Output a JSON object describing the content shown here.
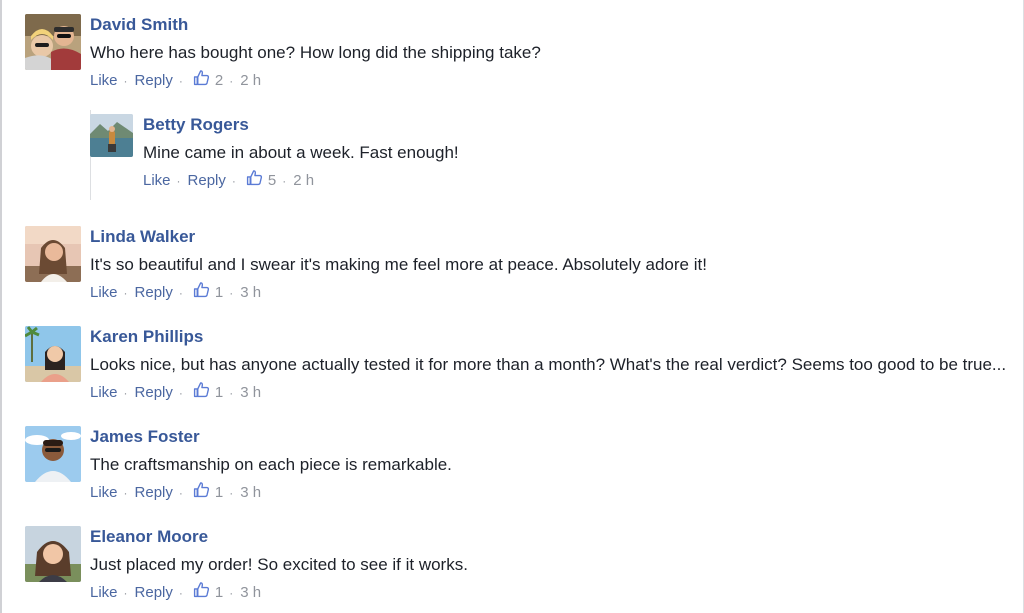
{
  "comments": [
    {
      "author": "David Smith",
      "text": "Who here has bought one? How long did the shipping take?",
      "like_label": "Like",
      "reply_label": "Reply",
      "likes": "2",
      "time": "2 h",
      "avatar_icon": "avatar-photo-couple",
      "replies": [
        {
          "author": "Betty Rogers",
          "text": "Mine came in about a week. Fast enough!",
          "like_label": "Like",
          "reply_label": "Reply",
          "likes": "5",
          "time": "2 h",
          "avatar_icon": "avatar-photo-lake"
        }
      ]
    },
    {
      "author": "Linda Walker",
      "text": "It's so beautiful and I swear it's making me feel more at peace. Absolutely adore it!",
      "like_label": "Like",
      "reply_label": "Reply",
      "likes": "1",
      "time": "3 h",
      "avatar_icon": "avatar-photo-woman-outdoor"
    },
    {
      "author": "Karen Phillips",
      "text": "Looks nice, but has anyone actually tested it for more than a month? What's the real verdict? Seems too good to be true...",
      "like_label": "Like",
      "reply_label": "Reply",
      "likes": "1",
      "time": "3 h",
      "avatar_icon": "avatar-photo-woman-palms"
    },
    {
      "author": "James Foster",
      "text": "The craftsmanship on each piece is remarkable.",
      "like_label": "Like",
      "reply_label": "Reply",
      "likes": "1",
      "time": "3 h",
      "avatar_icon": "avatar-photo-man-sky"
    },
    {
      "author": "Eleanor Moore",
      "text": "Just placed my order! So excited to see if it works.",
      "like_label": "Like",
      "reply_label": "Reply",
      "likes": "1",
      "time": "3 h",
      "avatar_icon": "avatar-photo-woman-selfie"
    }
  ],
  "colors": {
    "author": "#385898",
    "link": "#4b67a1",
    "meta": "#90949c",
    "text": "#1d2129",
    "like_icon": "#5b7bd5"
  }
}
